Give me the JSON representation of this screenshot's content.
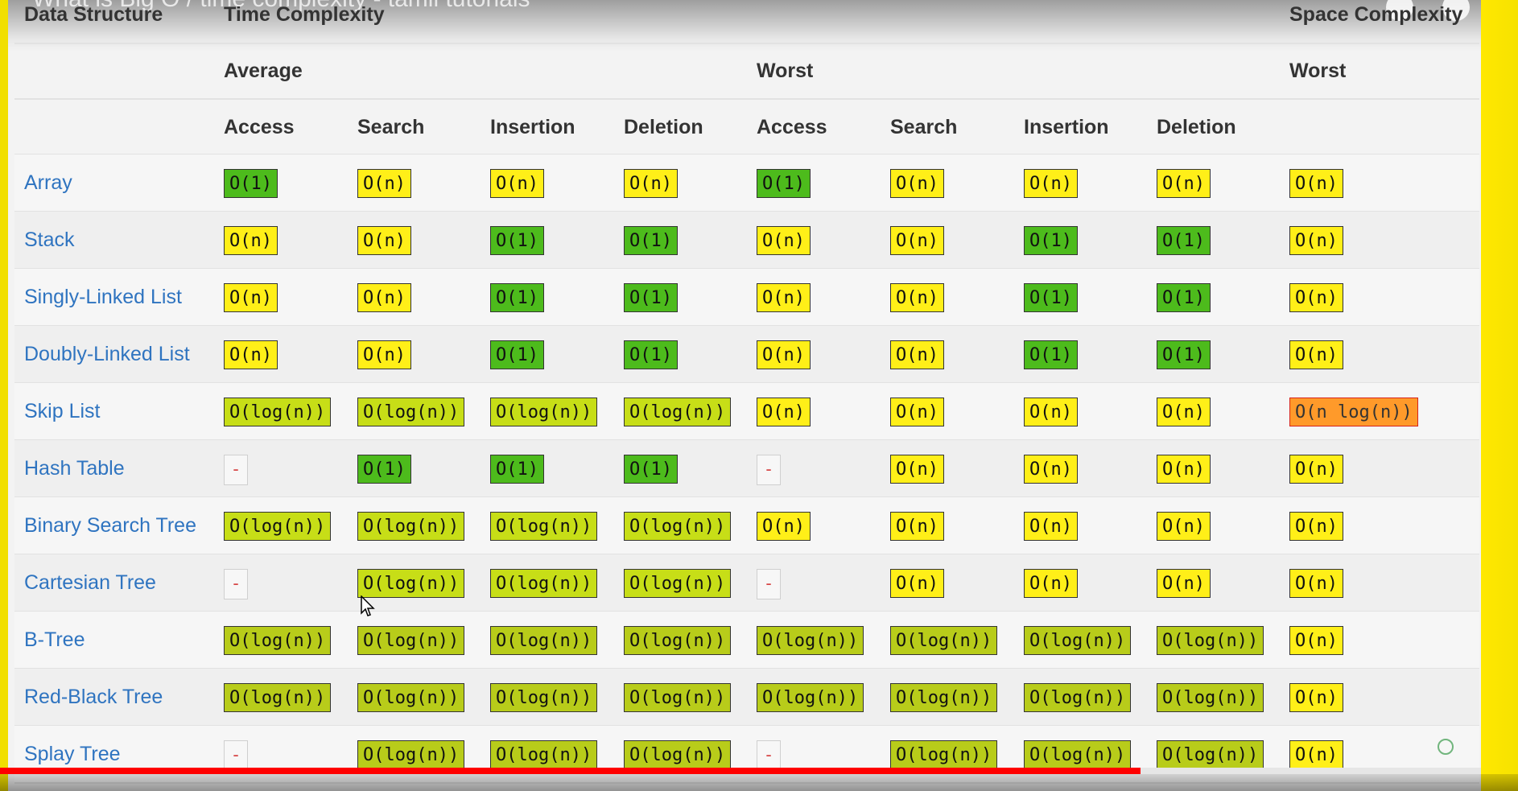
{
  "video": {
    "title": "What is Big O / time complexity - tamil tutorials"
  },
  "table": {
    "headers": {
      "data_structure": "Data Structure",
      "time_complexity": "Time Complexity",
      "space_complexity": "Space Complexity",
      "average": "Average",
      "worst": "Worst",
      "space_worst": "Worst",
      "ops": [
        "Access",
        "Search",
        "Insertion",
        "Deletion",
        "Access",
        "Search",
        "Insertion",
        "Deletion"
      ]
    },
    "rows": [
      {
        "name": "Array",
        "cells": [
          "O(1)",
          "O(n)",
          "O(n)",
          "O(n)",
          "O(1)",
          "O(n)",
          "O(n)",
          "O(n)",
          "O(n)"
        ]
      },
      {
        "name": "Stack",
        "cells": [
          "O(n)",
          "O(n)",
          "O(1)",
          "O(1)",
          "O(n)",
          "O(n)",
          "O(1)",
          "O(1)",
          "O(n)"
        ]
      },
      {
        "name": "Singly-Linked List",
        "cells": [
          "O(n)",
          "O(n)",
          "O(1)",
          "O(1)",
          "O(n)",
          "O(n)",
          "O(1)",
          "O(1)",
          "O(n)"
        ]
      },
      {
        "name": "Doubly-Linked List",
        "cells": [
          "O(n)",
          "O(n)",
          "O(1)",
          "O(1)",
          "O(n)",
          "O(n)",
          "O(1)",
          "O(1)",
          "O(n)"
        ]
      },
      {
        "name": "Skip List",
        "cells": [
          "O(log(n))",
          "O(log(n))",
          "O(log(n))",
          "O(log(n))",
          "O(n)",
          "O(n)",
          "O(n)",
          "O(n)",
          "O(n log(n))"
        ]
      },
      {
        "name": "Hash Table",
        "cells": [
          "-",
          "O(1)",
          "O(1)",
          "O(1)",
          "-",
          "O(n)",
          "O(n)",
          "O(n)",
          "O(n)"
        ]
      },
      {
        "name": "Binary Search Tree",
        "cells": [
          "O(log(n))",
          "O(log(n))",
          "O(log(n))",
          "O(log(n))",
          "O(n)",
          "O(n)",
          "O(n)",
          "O(n)",
          "O(n)"
        ]
      },
      {
        "name": "Cartesian Tree",
        "cells": [
          "-",
          "O(log(n))",
          "O(log(n))",
          "O(log(n))",
          "-",
          "O(n)",
          "O(n)",
          "O(n)",
          "O(n)"
        ]
      },
      {
        "name": "B-Tree",
        "cells": [
          "O(log(n))",
          "O(log(n))",
          "O(log(n))",
          "O(log(n))",
          "O(log(n))",
          "O(log(n))",
          "O(log(n))",
          "O(log(n))",
          "O(n)"
        ]
      },
      {
        "name": "Red-Black Tree",
        "cells": [
          "O(log(n))",
          "O(log(n))",
          "O(log(n))",
          "O(log(n))",
          "O(log(n))",
          "O(log(n))",
          "O(log(n))",
          "O(log(n))",
          "O(n)"
        ]
      },
      {
        "name": "Splay Tree",
        "cells": [
          "-",
          "O(log(n))",
          "O(log(n))",
          "O(log(n))",
          "-",
          "O(log(n))",
          "O(log(n))",
          "O(log(n))",
          "O(n)"
        ]
      }
    ]
  },
  "colors": {
    "green": "#4dbb1c",
    "yellow": "#ffef18",
    "yellow_green": "#c7de17",
    "olive": "#b8cc1a",
    "orange": "#ff9a2a",
    "progress": "#ff0000"
  },
  "player": {
    "progress_ratio": 0.77
  }
}
